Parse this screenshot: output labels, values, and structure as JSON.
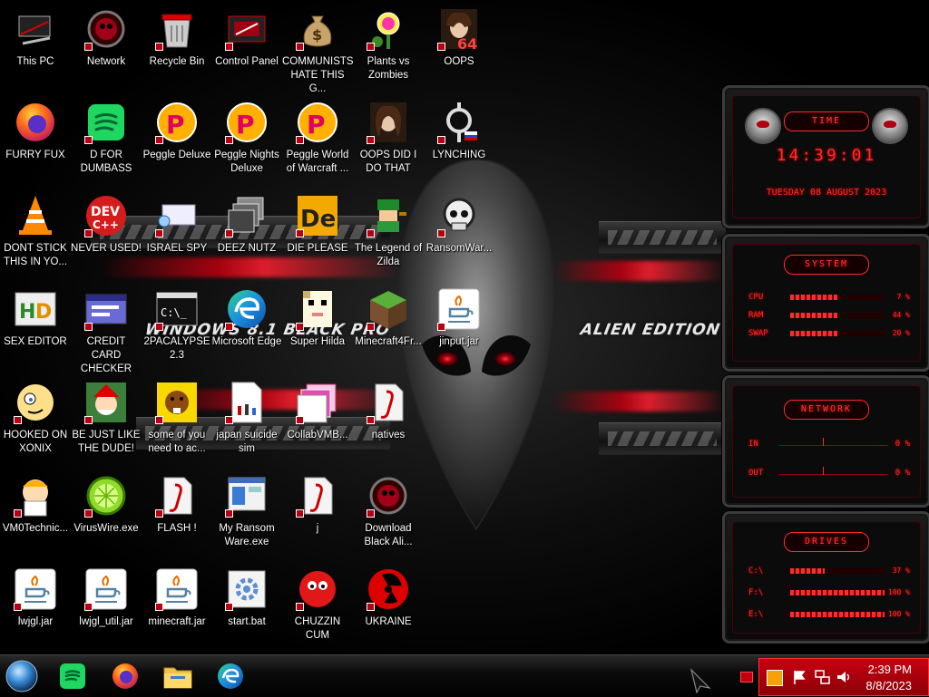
{
  "wallpaper": {
    "left_text": "WINDOWS 8.1 BLACK PRO",
    "right_text": "ALIEN EDITION 20"
  },
  "desktop_icons": [
    {
      "label": "This PC",
      "icon": "this-pc-icon"
    },
    {
      "label": "FURRY FUX",
      "icon": "firefox-icon"
    },
    {
      "label": "DONT STICK THIS IN YO...",
      "icon": "vlc-cone-icon"
    },
    {
      "label": "SEX EDITOR",
      "icon": "hxd-editor-icon"
    },
    {
      "label": "HOOKED ON XONIX",
      "icon": "cartoon-character-icon"
    },
    {
      "label": "VM0Technic...",
      "icon": "cartoon-scientist-icon"
    },
    {
      "label": "lwjgl.jar",
      "icon": "java-jar-icon"
    },
    {
      "label": "Network",
      "icon": "alienware-network-icon"
    },
    {
      "label": "D FOR DUMBASS",
      "icon": "spotify-like-icon"
    },
    {
      "label": "NEVER USED!",
      "icon": "dev-cpp-icon"
    },
    {
      "label": "CREDIT CARD CHECKER",
      "icon": "credit-card-window-icon"
    },
    {
      "label": "BE JUST LIKE THE DUDE!",
      "icon": "santa-game-icon"
    },
    {
      "label": "VirusWire.exe",
      "icon": "limewire-icon"
    },
    {
      "label": "lwjgl_util.jar",
      "icon": "java-jar-icon"
    },
    {
      "label": "Recycle Bin",
      "icon": "recycle-bin-icon"
    },
    {
      "label": "Peggle Deluxe",
      "icon": "peggle-icon"
    },
    {
      "label": "ISRAEL SPY",
      "icon": "spy-app-icon"
    },
    {
      "label": "2PACALYPSE 2.3",
      "icon": "terminal-icon"
    },
    {
      "label": "some of you need to ac...",
      "icon": "beaver-game-icon"
    },
    {
      "label": "FLASH !",
      "icon": "flash-file-icon"
    },
    {
      "label": "minecraft.jar",
      "icon": "java-jar-icon"
    },
    {
      "label": "Control Panel",
      "icon": "control-panel-icon"
    },
    {
      "label": "Peggle Nights Deluxe",
      "icon": "peggle-icon"
    },
    {
      "label": "DEEZ NUTZ",
      "icon": "stacked-windows-icon"
    },
    {
      "label": "Microsoft Edge",
      "icon": "edge-icon"
    },
    {
      "label": "japan suicide sim",
      "icon": "blank-document-icon"
    },
    {
      "label": "My Ransom Ware.exe",
      "icon": "application-window-icon"
    },
    {
      "label": "start.bat",
      "icon": "batch-file-icon"
    },
    {
      "label": "COMMUNISTS HATE THIS G...",
      "icon": "money-bag-icon"
    },
    {
      "label": "Peggle World of Warcraft ...",
      "icon": "peggle-icon"
    },
    {
      "label": "DIE PLEASE",
      "icon": "de-app-icon"
    },
    {
      "label": "Super Hilda",
      "icon": "pixel-character-icon"
    },
    {
      "label": "CollabVMB...",
      "icon": "collabvm-icon"
    },
    {
      "label": "j",
      "icon": "flash-file-icon"
    },
    {
      "label": "CHUZZIN CUM",
      "icon": "chuzzle-icon"
    },
    {
      "label": "Plants vs Zombies",
      "icon": "plants-vs-zombies-icon"
    },
    {
      "label": "OOPS DID I DO THAT",
      "icon": "portrait-icon"
    },
    {
      "label": "The Legend of Zilda",
      "icon": "pixel-hero-icon"
    },
    {
      "label": "Minecraft4Fr...",
      "icon": "minecraft-block-icon"
    },
    {
      "label": "natives",
      "icon": "flash-file-icon"
    },
    {
      "label": "Download Black Ali...",
      "icon": "alienware-network-icon"
    },
    {
      "label": "UKRAINE",
      "icon": "radiation-icon"
    },
    {
      "label": "OOPS",
      "icon": "portrait-64-icon"
    },
    {
      "label": "LYNCHING",
      "icon": "rope-icon"
    },
    {
      "label": "RansomWar...",
      "icon": "skull-icon"
    },
    {
      "label": "jinput.jar",
      "icon": "java-jar-icon"
    }
  ],
  "gadget": {
    "time": {
      "header": "TIME",
      "clock": "14:39:01",
      "date": "TUESDAY 08 AUGUST 2023"
    },
    "system": {
      "header": "SYSTEM",
      "rows": [
        {
          "label": "CPU",
          "value": "7 %",
          "level": 0.07
        },
        {
          "label": "RAM",
          "value": "44 %",
          "level": 0.44
        },
        {
          "label": "SWAP",
          "value": "20 %",
          "level": 0.2
        }
      ]
    },
    "network": {
      "header": "NETWORK",
      "rows": [
        {
          "label": "IN",
          "value": "0 %"
        },
        {
          "label": "OUT",
          "value": "0 %"
        }
      ]
    },
    "drives": {
      "header": "DRIVES",
      "rows": [
        {
          "label": "C:\\",
          "value": "37 %",
          "level": 0.37
        },
        {
          "label": "F:\\",
          "value": "100 %",
          "level": 1.0
        },
        {
          "label": "E:\\",
          "value": "100 %",
          "level": 1.0
        }
      ]
    }
  },
  "taskbar": {
    "pinned": [
      {
        "name": "start-orb",
        "icon": "start-orb-icon"
      },
      {
        "name": "spotify",
        "icon": "spotify-like-icon"
      },
      {
        "name": "firefox",
        "icon": "firefox-icon"
      },
      {
        "name": "file-explorer",
        "icon": "folder-icon"
      },
      {
        "name": "edge",
        "icon": "edge-icon"
      }
    ],
    "clock": {
      "time": "2:39 PM",
      "date": "8/8/2023"
    }
  },
  "colors": {
    "accent_red": "#ff2a2a",
    "tray_red": "#c80010"
  }
}
